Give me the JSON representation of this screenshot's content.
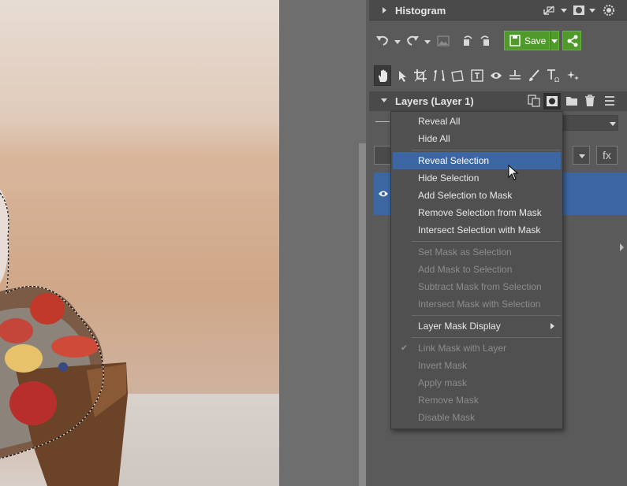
{
  "histogram": {
    "title": "Histogram"
  },
  "toolbar": {
    "save_label": "Save",
    "fx_label": "fx"
  },
  "layers_panel": {
    "title": "Layers (Layer 1)"
  },
  "context_menu": {
    "items": [
      {
        "label": "Reveal All",
        "enabled": true
      },
      {
        "label": "Hide All",
        "enabled": true
      },
      {
        "label": "Reveal Selection",
        "enabled": true,
        "highlighted": true
      },
      {
        "label": "Hide Selection",
        "enabled": true
      },
      {
        "label": "Add Selection to Mask",
        "enabled": true
      },
      {
        "label": "Remove Selection from Mask",
        "enabled": true
      },
      {
        "label": "Intersect Selection with Mask",
        "enabled": true
      },
      {
        "label": "Set Mask as Selection",
        "enabled": false
      },
      {
        "label": "Add Mask to Selection",
        "enabled": false
      },
      {
        "label": "Subtract Mask from Selection",
        "enabled": false
      },
      {
        "label": "Intersect Mask with Selection",
        "enabled": false
      },
      {
        "label": "Layer Mask Display",
        "enabled": true,
        "submenu": true
      },
      {
        "label": "Link Mask with Layer",
        "enabled": false,
        "checked": true
      },
      {
        "label": "Invert Mask",
        "enabled": false
      },
      {
        "label": "Apply mask",
        "enabled": false
      },
      {
        "label": "Remove Mask",
        "enabled": false
      },
      {
        "label": "Disable Mask",
        "enabled": false
      }
    ]
  },
  "colors": {
    "accent_green": "#4f9a2a",
    "selection_blue": "#3d67a3",
    "panel_bg": "#5a5a5a",
    "header_bg": "#4a4a4a"
  },
  "icons": {
    "histogram_header": [
      "chevron-right-icon",
      "view-mode-icon",
      "mask-view-icon",
      "settings-gear-icon"
    ],
    "toolbar1": [
      "undo-icon",
      "redo-icon",
      "image-icon",
      "rotate-left-icon",
      "rotate-right-icon",
      "save-icon",
      "share-icon"
    ],
    "tools": [
      "hand-tool-icon",
      "select-tool-icon",
      "crop-tool-icon",
      "straighten-tool-icon",
      "transform-tool-icon",
      "text-frame-tool-icon",
      "eye-tool-icon",
      "level-tool-icon",
      "brush-tool-icon",
      "text-tool-icon",
      "effects-tool-icon"
    ],
    "layers_header": [
      "chevron-down-icon",
      "duplicate-layer-icon",
      "layer-mask-icon",
      "folder-icon",
      "trash-icon",
      "menu-icon"
    ]
  }
}
